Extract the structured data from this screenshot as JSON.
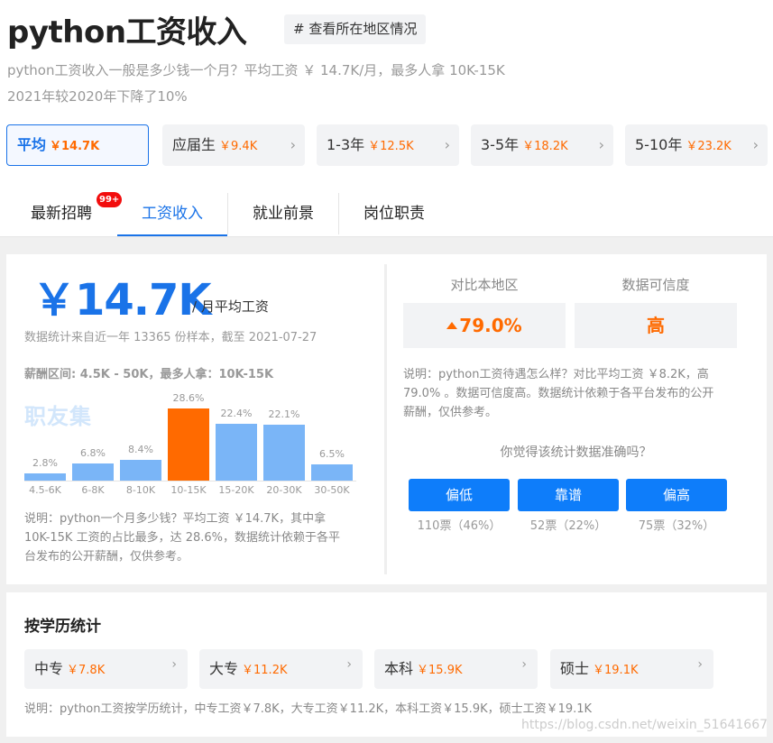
{
  "header": {
    "title": "python工资收入",
    "region_button": "# 查看所在地区情况",
    "summary_line1": "python工资收入一般是多少钱一个月？平均工资 ￥ 14.7K/月，最多人拿 10K-15K",
    "summary_line2": "2021年较2020年下降了10%"
  },
  "tiers": [
    {
      "label": "平均",
      "value": "￥14.7K",
      "active": true
    },
    {
      "label": "应届生",
      "value": "￥9.4K",
      "active": false
    },
    {
      "label": "1-3年",
      "value": "￥12.5K",
      "active": false
    },
    {
      "label": "3-5年",
      "value": "￥18.2K",
      "active": false
    },
    {
      "label": "5-10年",
      "value": "￥23.2K",
      "active": false
    }
  ],
  "tabs": [
    {
      "label": "最新招聘",
      "active": false,
      "badge": "99+"
    },
    {
      "label": "工资收入",
      "active": true
    },
    {
      "label": "就业前景",
      "active": false
    },
    {
      "label": "岗位职责",
      "active": false
    }
  ],
  "salary": {
    "big_value": "￥14.7K",
    "unit": "/ 月平均工资",
    "source": "数据统计来自近一年 13365 份样本，截至 2021-07-27",
    "range": "薪酬区间: 4.5K - 50K，最多人拿：10K-15K",
    "watermark": "职友集",
    "note_line1": "说明：python一个月多少钱？平均工资 ￥14.7K，其中拿",
    "note_line2": "10K-15K 工资的占比最多，达 28.6%，数据统计依赖于各平",
    "note_line3": "台发布的公开薪酬，仅供参考。"
  },
  "chart_data": {
    "type": "bar",
    "title": "",
    "xlabel": "",
    "ylabel": "",
    "categories": [
      "4.5-6K",
      "6-8K",
      "8-10K",
      "10-15K",
      "15-20K",
      "20-30K",
      "30-50K"
    ],
    "values": [
      2.8,
      6.8,
      8.4,
      28.6,
      22.4,
      22.1,
      6.5
    ],
    "labels": [
      "2.8%",
      "6.8%",
      "8.4%",
      "28.6%",
      "22.4%",
      "22.1%",
      "6.5%"
    ],
    "highlight_index": 3,
    "colors": {
      "bar": "#7ab5f7",
      "highlight": "#ff6a00"
    },
    "ylim": [
      0,
      28.6
    ],
    "grid": false
  },
  "compare": {
    "label_local": "对比本地区",
    "label_reliability": "数据可信度",
    "local_value": "79.0%",
    "reliability_value": "高",
    "note_line1": "说明：python工资待遇怎么样？对比平均工资 ￥8.2K，高",
    "note_line2": "79.0% 。数据可信度高。数据统计依赖于各平台发布的公开",
    "note_line3": "薪酬，仅供参考。",
    "question": "你觉得该统计数据准确吗？",
    "votes": [
      {
        "label": "偏低",
        "count": "110票（46%）"
      },
      {
        "label": "靠谱",
        "count": "52票（22%）"
      },
      {
        "label": "偏高",
        "count": "75票（32%）"
      }
    ]
  },
  "education": {
    "title": "按学历统计",
    "items": [
      {
        "label": "中专",
        "value": "￥7.8K"
      },
      {
        "label": "大专",
        "value": "￥11.2K"
      },
      {
        "label": "本科",
        "value": "￥15.9K"
      },
      {
        "label": "硕士",
        "value": "￥19.1K"
      }
    ],
    "note": "说明：python工资按学历统计，中专工资￥7.8K，大专工资￥11.2K，本科工资￥15.9K，硕士工资￥19.1K"
  },
  "footer": {
    "watermark_url": "https://blog.csdn.net/weixin_51641667"
  },
  "colors": {
    "accent": "#1a73e8",
    "money": "#ff6a00",
    "vote_button": "#0e7dfa",
    "badge": "#f20d0d"
  }
}
